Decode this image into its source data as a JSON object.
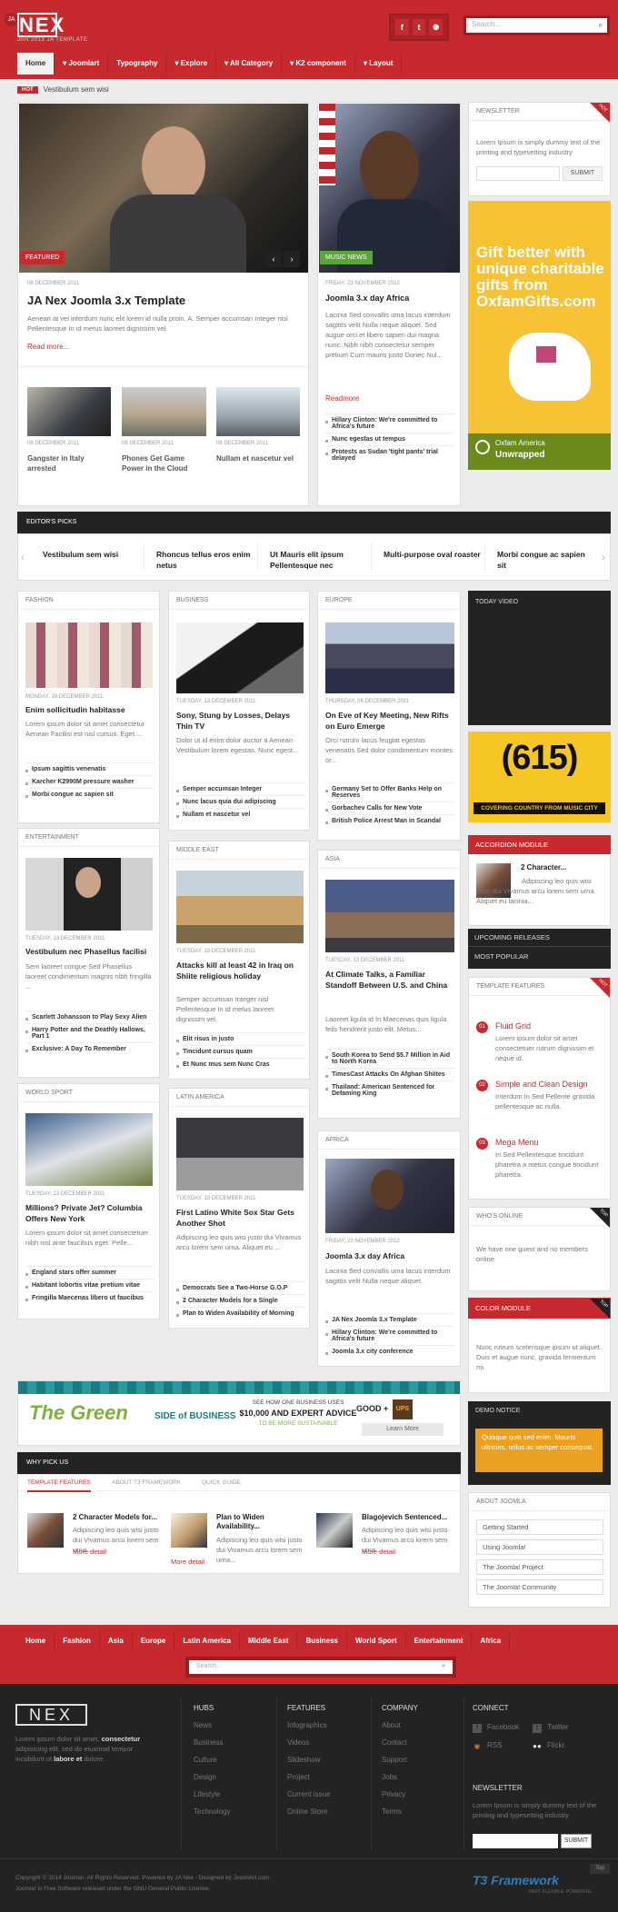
{
  "brand": {
    "logo": "NEX",
    "ja": "JA",
    "tagline": "JAN 2013 JA TEMPLATE"
  },
  "social": [
    "f",
    "t",
    "rss"
  ],
  "search": {
    "placeholder": "Search..."
  },
  "nav": [
    "Home",
    "Joomlart",
    "Typography",
    "Explore",
    "All Category",
    "K2 component",
    "Layout"
  ],
  "hot": {
    "tag": "HOT",
    "text": "Vestibulum sem wisi"
  },
  "featured": {
    "tag": "FEATURED",
    "date": "08 DECEMBER 2011",
    "title": "JA Nex Joomla 3.x Template",
    "body": "Aenean at vel interdum nunc elit lorem id nulla proin. A. Semper accumsan Integer nisl Pellentesque In id metus laoreet dignissim vel.",
    "more": "Read more..."
  },
  "thumbs": [
    {
      "date": "08 DECEMBER 2011",
      "title": "Gangster in Italy arrested"
    },
    {
      "date": "08 DECEMBER 2011",
      "title": "Phones Get Game Power in the Cloud"
    },
    {
      "date": "08 DECEMBER 2011",
      "title": "Nullam et nascetur vel"
    }
  ],
  "music": {
    "tag": "MUSIC NEWS",
    "date": "FRIDAY, 23 NOVEMBER 2012",
    "title": "Joomla 3.x day Africa",
    "body": "Lacinia Sed convallis uma lacus interdum sagittis velit Nulla neque aliquet. Sed augue orci et libero sapien dui magna nunc. Nibh nibh consectetur semper pretium Cum mauris justo Donec Nul...",
    "more": "Readmore",
    "list": [
      "Hillary Clinton: We're committed to Africa's future",
      "Nunc egestas ut tempus",
      "Protests as Sudan 'tight pants' trial delayed"
    ]
  },
  "newsletter": {
    "title": "NEWSLETTER",
    "corner": "HOT",
    "text": "Lorem Ipsum is simply dummy text of the printing and typesetting industry",
    "button": "SUBMIT"
  },
  "oxfam": {
    "headline": "Gift better with unique charitable gifts from OxfamGifts.com",
    "brand": "Oxfam America",
    "sub": "Unwrapped"
  },
  "editors": {
    "title": "EDITOR'S PICKS",
    "items": [
      "Vestibulum sem wisi",
      "Rhoncus tellus eros enim netus",
      "Ut Mauris elit ipsum Pellentesque nec",
      "Multi-purpose oval roaster",
      "Morbi congue ac sapien sit"
    ]
  },
  "fashion": {
    "cat": "FASHION",
    "date": "MONDAY, 19 DECEMBER 2011",
    "title": "Enim sollicitudin habitasse",
    "body": "Lorem ipsum dolor sit amet consectetur Aenean Facilisi est nisl cursus. Eget ...",
    "list": [
      "Ipsum sagittis venenatis",
      "Karcher K2990M pressure washer",
      "Morbi congue ac sapien sit"
    ]
  },
  "business": {
    "cat": "BUSINESS",
    "date": "TUESDAY, 13 DECEMBER 2011",
    "title": "Sony, Stung by Losses, Delays Thin TV",
    "body": "Dolor ut id enim dolor auctor a Aenean Vestibulum lorem egestas. Nunc egest...",
    "list": [
      "Semper accumsan Integer",
      "Nunc lacus quia dui adipiscing",
      "Nullam et nascetur vel"
    ]
  },
  "europe": {
    "cat": "EUROPE",
    "date": "THURSDAY, 08 DECEMBER 2011",
    "title": "On Eve of Key Meeting, New Rifts on Euro Emerge",
    "body": "Orci rutrum lacus feugiat egestas venenatis Sed dolor condimentum montes or...",
    "list": [
      "Germany Set to Offer Banks Help on Reserves",
      "Gorbachev Calls for New Vote",
      "British Police Arrest Man in Scandal"
    ]
  },
  "todayvideo": {
    "title": "TODAY VIDEO"
  },
  "ad615": {
    "number": "(615)",
    "strip": "COVERING COUNTRY FROM MUSIC CITY"
  },
  "accordion": {
    "title": "ACCORDION MODULE",
    "item": "2 Character...",
    "body": "Adipiscing leo quis wisi justo dui Vivamus arcu lorem sem urna. Aliquet eu lacinia...",
    "tabs": [
      "UPCOMING RELEASES",
      "MOST POPULAR"
    ]
  },
  "entertainment": {
    "cat": "ENTERTAINMENT",
    "date": "TUESDAY, 13 DECEMBER 2011",
    "title": "Vestibulum nec Phasellus facilisi",
    "body": "Sem laoreet congue Sed Phasellus laoreet condimentum magnis nibh fringilla ...",
    "list": [
      "Scarlett Johansson to Play Sexy Alien",
      "Harry Potter and the Deathly Hallows, Part 1",
      "Exclusive: A Day To Remember"
    ]
  },
  "middleeast": {
    "cat": "MIDDLE EAST",
    "date": "TUESDAY, 13 DECEMBER 2011",
    "title": "Attacks kill at least 42 in Iraq on Shiite religious holiday",
    "body": "Semper accumsan Integer nisl Pellentesque In id metus laoreet dignissim vel.",
    "list": [
      "Elit risus in justo",
      "Tincidunt cursus quam",
      "Et Nunc mus sem Nunc Cras"
    ]
  },
  "asia": {
    "cat": "ASIA",
    "date": "TUESDAY, 13 DECEMBER 2011",
    "title": "At Climate Talks, a Familiar Standoff Between U.S. and China",
    "body": "Laoreet ligula id In Maecenas quis ligula felis hendrerit justo elit. Metus...",
    "list": [
      "South Korea to Send $5.7 Million in Aid to North Korea",
      "TimesCast Attacks On Afghan Shiites",
      "Thailand: American Sentenced for Defaming King"
    ]
  },
  "templatefeatures": {
    "title": "TEMPLATE FEATURES",
    "corner": "HOT",
    "items": [
      {
        "n": "01",
        "title": "Fluid Grid",
        "body": "Lorem ipsum dolor sit amet consectetuer rutrum dignissim et neque id."
      },
      {
        "n": "02",
        "title": "Simple and Clean Design",
        "body": "Interdum In Sed Pellente gravida pellentesque ac nulla."
      },
      {
        "n": "03",
        "title": "Mega Menu",
        "body": "In Sed Pellentesque tincidunt pharetra a metus congue tincidunt pharetra."
      }
    ]
  },
  "worldsport": {
    "cat": "WORLD SPORT",
    "date": "TUESDAY, 13 DECEMBER 2011",
    "title": "Millions? Private Jet? Columbia Offers New York",
    "body": "Lorem ipsum dolor sit amet consectetuer nibh nisl ante faucibus eget. Pelle...",
    "list": [
      "England stars offer summer",
      "Habitant lobortis vitae pretium vitae",
      "Fringilla Maecenas libero ut faucibus"
    ]
  },
  "latinamerica": {
    "cat": "LATIN AMERICA",
    "date": "TUESDAY, 13 DECEMBER 2011",
    "title": "First Latino White Sox Star Gets Another Shot",
    "body": "Adipiscing leo quis wisi justo dui Vivamus arcu lorem sem urna. Aliquet eu ...",
    "list": [
      "Democrats See a Two-Horse G.O.P",
      "2 Character Models for a Single",
      "Plan to Widen Availability of Morning"
    ]
  },
  "africa": {
    "cat": "AFRICA",
    "date": "FRIDAY, 23 NOVEMBER 2012",
    "title": "Joomla 3.x day Africa",
    "body": "Lacinia Sed convallis uma lacus interdum sagittis velit Nulla neque aliquet.",
    "list": [
      "JA Nex Joomla 3.x Template",
      "Hillary Clinton: We're committed to Africa's future",
      "Joomla 3.x city conference"
    ]
  },
  "whosonline": {
    "title": "WHO'S ONLINE",
    "corner": "TOP",
    "text": "We have one guest and no members online"
  },
  "colormodule": {
    "title": "COLOR MODULE",
    "corner": "TOP",
    "text": "Nunc rutrum scelerisque ipsum ut aliquet. Duis et augue nunc, gravida fermentum mi."
  },
  "greenbanner": {
    "green": "The Green",
    "side": "SIDE of BUSINESS",
    "offer1": "SEE HOW ONE BUSINESS USES",
    "offer2": "$10,000 AND EXPERT ADVICE",
    "offer3": "TO BE MORE SUSTAINABLE",
    "good": "GOOD +",
    "ups": "UPS",
    "learn": "Learn More"
  },
  "demonotice": {
    "title": "DEMO NOTICE",
    "text": "Quisque quis sed enim. Mauris ultricies, tellus ac semper consequat."
  },
  "whypick": {
    "title": "WHY PICK US",
    "tabs": [
      "TEMPLATE FEATURES",
      "ABOUT T3 FRAMEWORK",
      "QUICK GUIDE"
    ],
    "items": [
      {
        "title": "2 Character Models for...",
        "body": "Adipiscing leo quis wisi justo dui Vivamus arcu lorem sem urna...",
        "more": "More detail"
      },
      {
        "title": "Plan to Widen Availability...",
        "body": "Adipiscing leo quis wisi justo dui Vivamus arcu lorem sem urna...",
        "more": "More detail"
      },
      {
        "title": "Blagojevich Sentenced...",
        "body": "Adipiscing leo quis wisi justo dui Vivamus arcu lorem sem urna...",
        "more": "More detail"
      }
    ]
  },
  "aboutjoomla": {
    "title": "ABOUT JOOMLA",
    "links": [
      "Getting Started",
      "Using Joomla!",
      "The Joomla! Project",
      "The Joomla! Community"
    ]
  },
  "footnav": [
    "Home",
    "Fashion",
    "Asia",
    "Europe",
    "Latin America",
    "Middle East",
    "Business",
    "World Sport",
    "Entertainment",
    "Africa"
  ],
  "footer": {
    "logo": "NEX",
    "about_pre": "Lorem ipsum dolor sit amet, ",
    "about_b1": "consectetur",
    "about_mid": " adipisicing elit, sed do eiusmod tempor incididunt ut ",
    "about_b2": "labore et",
    "about_end": " dolore.",
    "cols": [
      {
        "h": "HUBS",
        "links": [
          "News",
          "Business",
          "Culture",
          "Design",
          "Lifestyle",
          "Technology"
        ]
      },
      {
        "h": "FEATURES",
        "links": [
          "Infographics",
          "Videos",
          "Slideshow",
          "Project",
          "Current issue",
          "Online Store"
        ]
      },
      {
        "h": "COMPANY",
        "links": [
          "About",
          "Contact",
          "Support",
          "Jobs",
          "Privacy",
          "Terms"
        ]
      }
    ],
    "connect": {
      "h": "CONNECT",
      "links": [
        "Facebook",
        "Twitter",
        "RSS",
        "Flickr"
      ]
    },
    "newsletter": {
      "h": "NEWSLETTER",
      "text": "Lorem Ipsum is simply dummy text of the printing and typesetting industry",
      "button": "SUBMIT"
    },
    "copyright": "Copyright © 2014 Joomla!. All Rights Reserved. Powered by JA Nex - Designed by JoomlArt.com.",
    "license": "Joomla! is Free Software released under the GNU General Public License.",
    "t3": "T3 Framework",
    "t3sub": "FAST. FLEXIBLE. POWERFUL.",
    "top": "Top"
  }
}
